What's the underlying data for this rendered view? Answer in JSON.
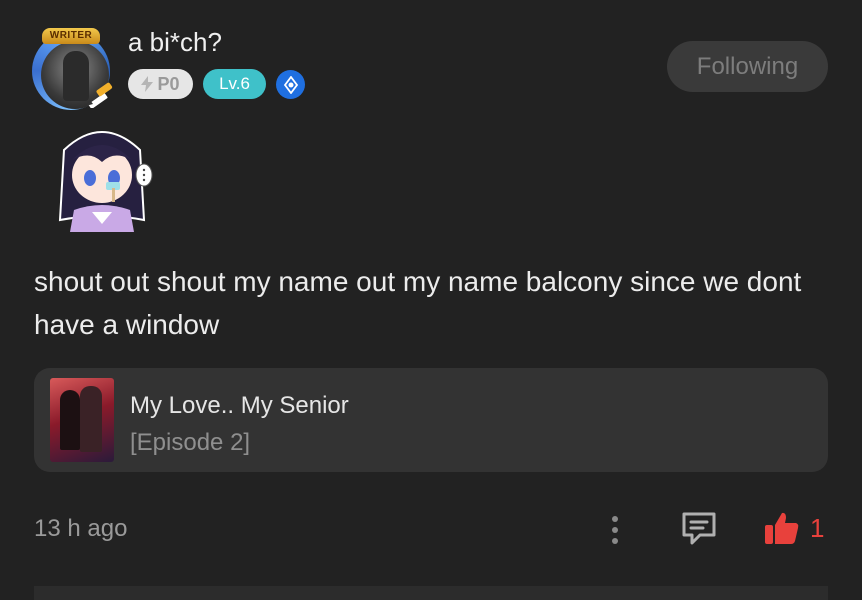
{
  "author": {
    "name": "a bi*ch?",
    "writer_badge": "WRITER",
    "points_badge": "P0",
    "level_badge": "Lv.6",
    "avatar_ring_color": "#4a8ef0"
  },
  "follow_button": {
    "label": "Following"
  },
  "post": {
    "text": "shout out shout my name out my name balcony since we dont have a window"
  },
  "linked_episode": {
    "series_title": "My Love.. My Senior",
    "episode_label": "[Episode 2]"
  },
  "footer": {
    "time_ago": "13 h ago",
    "like_count": "1",
    "icons": [
      "more-options-icon",
      "comment-icon",
      "thumbs-up-icon"
    ]
  },
  "colors": {
    "background": "#222222",
    "card": "#333333",
    "level_badge": "#3fc1c9",
    "like_red": "#e8413c",
    "blue_badge": "#1f6fe0"
  }
}
